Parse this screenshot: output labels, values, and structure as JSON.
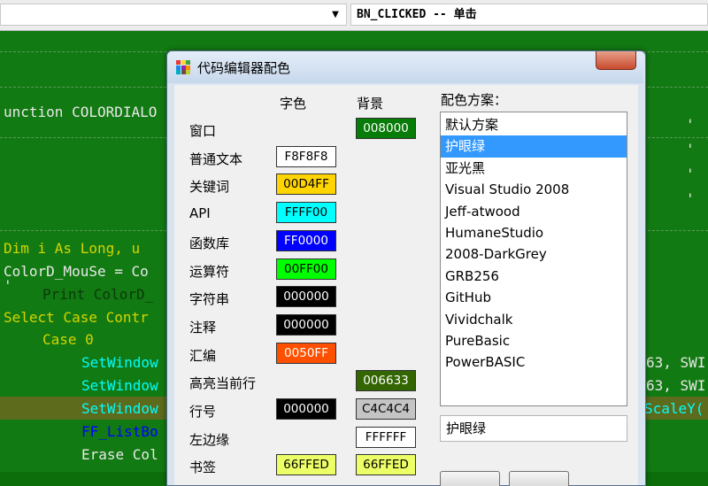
{
  "combo": {
    "event_text": "BN_CLICKED -- 单击"
  },
  "code": {
    "line1": "unction COLORDIALO",
    "line2": "Dim i As Long, u",
    "line3": "ColorD_MouSe = Co",
    "line4": "Print ColorD_",
    "line5": "Select Case Contr",
    "line6": "Case 0",
    "line7": "SetWindow",
    "line8": "SetWindow",
    "line9": "SetWindow",
    "line10": "FF_ListBo",
    "line11": "Erase Col",
    "right1": "63, SWI",
    "right2": "63, SWI",
    "right3": "ScaleY(",
    "tick": "'"
  },
  "dialog": {
    "title": "代码编辑器配色",
    "header_fore": "字色",
    "header_back": "背景",
    "header_scheme": "配色方案：",
    "rows": [
      {
        "label": "窗口",
        "back": "008000",
        "back_color": "#087c08",
        "back_text_color": "#ffffff"
      },
      {
        "label": "普通文本",
        "fore": "F8F8F8",
        "fore_color": "#ffffff",
        "fore_text_color": "#000000"
      },
      {
        "label": "关键词",
        "fore": "00D4FF",
        "fore_color": "#ffd400",
        "fore_text_color": "#000000"
      },
      {
        "label": "API",
        "fore": "FFFF00",
        "fore_color": "#00ffff",
        "fore_text_color": "#000000"
      },
      {
        "label": "函数库",
        "fore": "FF0000",
        "fore_color": "#0000ff",
        "fore_text_color": "#ffffff"
      },
      {
        "label": "运算符",
        "fore": "00FF00",
        "fore_color": "#00ff00",
        "fore_text_color": "#000000"
      },
      {
        "label": "字符串",
        "fore": "000000",
        "fore_color": "#000000",
        "fore_text_color": "#ffffff"
      },
      {
        "label": "注释",
        "fore": "000000",
        "fore_color": "#000000",
        "fore_text_color": "#ffffff"
      },
      {
        "label": "汇编",
        "fore": "0050FF",
        "fore_color": "#ff5000",
        "fore_text_color": "#ffffff"
      },
      {
        "label": "高亮当前行",
        "back": "006633",
        "back_color": "#336600",
        "back_text_color": "#ffffff"
      },
      {
        "label": "行号",
        "fore": "000000",
        "fore_color": "#000000",
        "fore_text_color": "#ffffff",
        "back": "C4C4C4",
        "back_color": "#c4c4c4",
        "back_text_color": "#000000"
      },
      {
        "label": "左边缘",
        "back": "FFFFFF",
        "back_color": "#ffffff",
        "back_text_color": "#000000"
      },
      {
        "label": "书签",
        "fore": "66FFED",
        "fore_color": "#edff66",
        "fore_text_color": "#000000",
        "back": "66FFED",
        "back_color": "#edff66",
        "back_text_color": "#000000"
      }
    ],
    "schemes": [
      "默认方案",
      "护眼绿",
      "亚光黑",
      "Visual Studio 2008",
      "Jeff-atwood",
      "HumaneStudio",
      "2008-DarkGrey",
      "GRB256",
      "GitHub",
      "Vividchalk",
      "PureBasic",
      "PowerBASIC"
    ],
    "selected_scheme_index": 1,
    "scheme_name_value": "护眼绿"
  },
  "colors": {
    "editor_bg": "#127a12",
    "keyword": "#d4d400",
    "api": "#00ffff",
    "function": "#0000ff",
    "text": "#e8e8e8",
    "selection": "#3399ff"
  }
}
